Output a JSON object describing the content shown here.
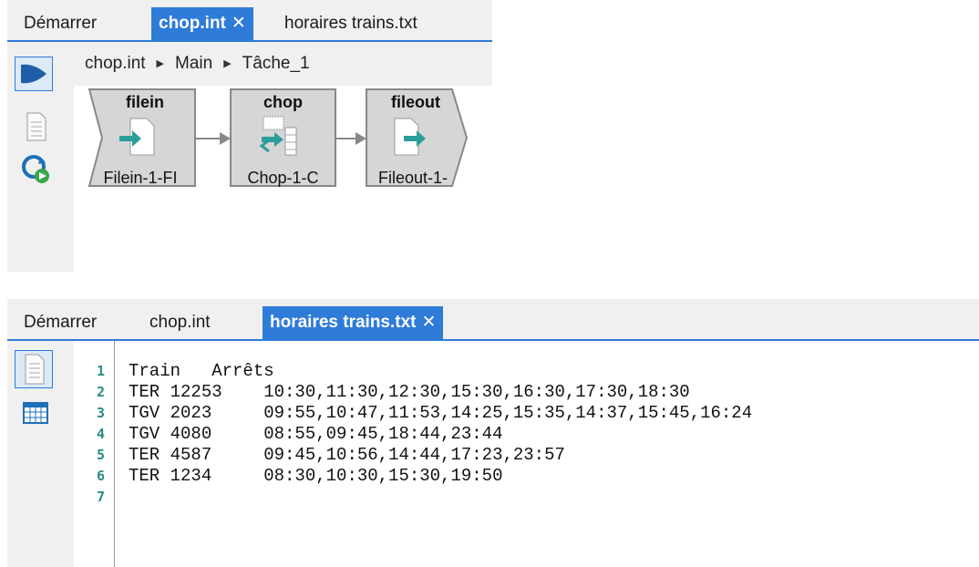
{
  "top_panel": {
    "tabs": [
      {
        "label": "Démarrer"
      },
      {
        "label": "chop.int",
        "close": "✕"
      },
      {
        "label": "horaires trains.txt"
      }
    ],
    "breadcrumb": [
      "chop.int",
      "Main",
      "Tâche_1"
    ],
    "nodes": [
      {
        "title": "filein",
        "label": "Filein-1-FI"
      },
      {
        "title": "chop",
        "label": "Chop-1-C"
      },
      {
        "title": "fileout",
        "label": "Fileout-1-"
      }
    ]
  },
  "bottom_panel": {
    "tabs": [
      {
        "label": "Démarrer"
      },
      {
        "label": "chop.int"
      },
      {
        "label": "horaires trains.txt",
        "close": "✕"
      }
    ],
    "line_numbers": [
      "1",
      "2",
      "3",
      "4",
      "5",
      "6",
      "7"
    ],
    "lines": [
      "Train   Arrêts",
      "TER 12253    10:30,11:30,12:30,15:30,16:30,17:30,18:30",
      "TGV 2023     09:55,10:47,11:53,14:25,15:35,14:37,15:45,16:24",
      "TGV 4080     08:55,09:45,18:44,23:44",
      "TER 4587     09:45,10:56,14:44,17:23,23:57",
      "TER 1234     08:30,10:30,15:30,19:50",
      ""
    ]
  },
  "colors": {
    "accent": "#2e7bd8",
    "node_fill": "#d8d8d8",
    "node_border": "#8c8c8c",
    "icon_teal": "#2b9e9a"
  }
}
